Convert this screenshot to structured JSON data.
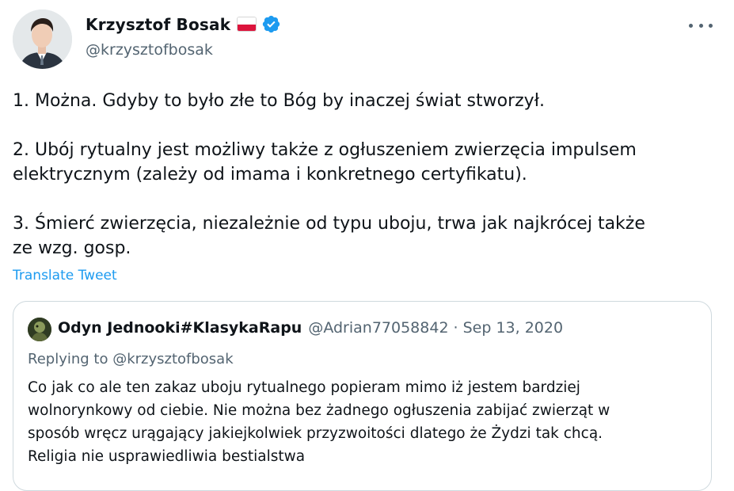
{
  "author": {
    "name": "Krzysztof Bosak",
    "handle": "@krzysztofbosak",
    "flag_icon": "poland-flag-icon",
    "verified_icon": "verified-badge-icon",
    "verified_color": "#1d9bf0"
  },
  "more_icon": "more-horizontal-icon",
  "tweet": {
    "paragraphs": [
      [
        "1. Można. Gdyby to było złe to Bóg by inaczej świat stworzył."
      ],
      [
        "2. Ubój rytualny jest możliwy także z ogłuszeniem zwierzęcia impulsem",
        "elektrycznym (zależy od imama i konkretnego certyfikatu)."
      ],
      [
        "3. Śmierć zwierzęcia, niezależnie od typu uboju, trwa jak najkrócej także",
        "ze wzg. gosp."
      ]
    ]
  },
  "translate_label": "Translate Tweet",
  "quoted": {
    "name": "Odyn Jednooki#KlasykaRapu",
    "handle": "@Adrian77058842",
    "separator": "·",
    "date": "Sep 13, 2020",
    "replying_to": "Replying to @krzysztofbosak",
    "lines": [
      "Co jak co ale ten zakaz uboju rytualnego popieram mimo iż jestem bardziej",
      "wolnorynkowy od ciebie. Nie można bez żadnego ogłuszenia zabijać zwierząt w",
      "sposób wręcz urągający jakiejkolwiek przyzwoitości dlatego że Żydzi tak chcą.",
      "Religia nie usprawiedliwia bestialstwa"
    ]
  },
  "colors": {
    "link": "#1d9bf0",
    "secondary_text": "#536471",
    "primary_text": "#0f1419",
    "border": "#cfd9de"
  }
}
